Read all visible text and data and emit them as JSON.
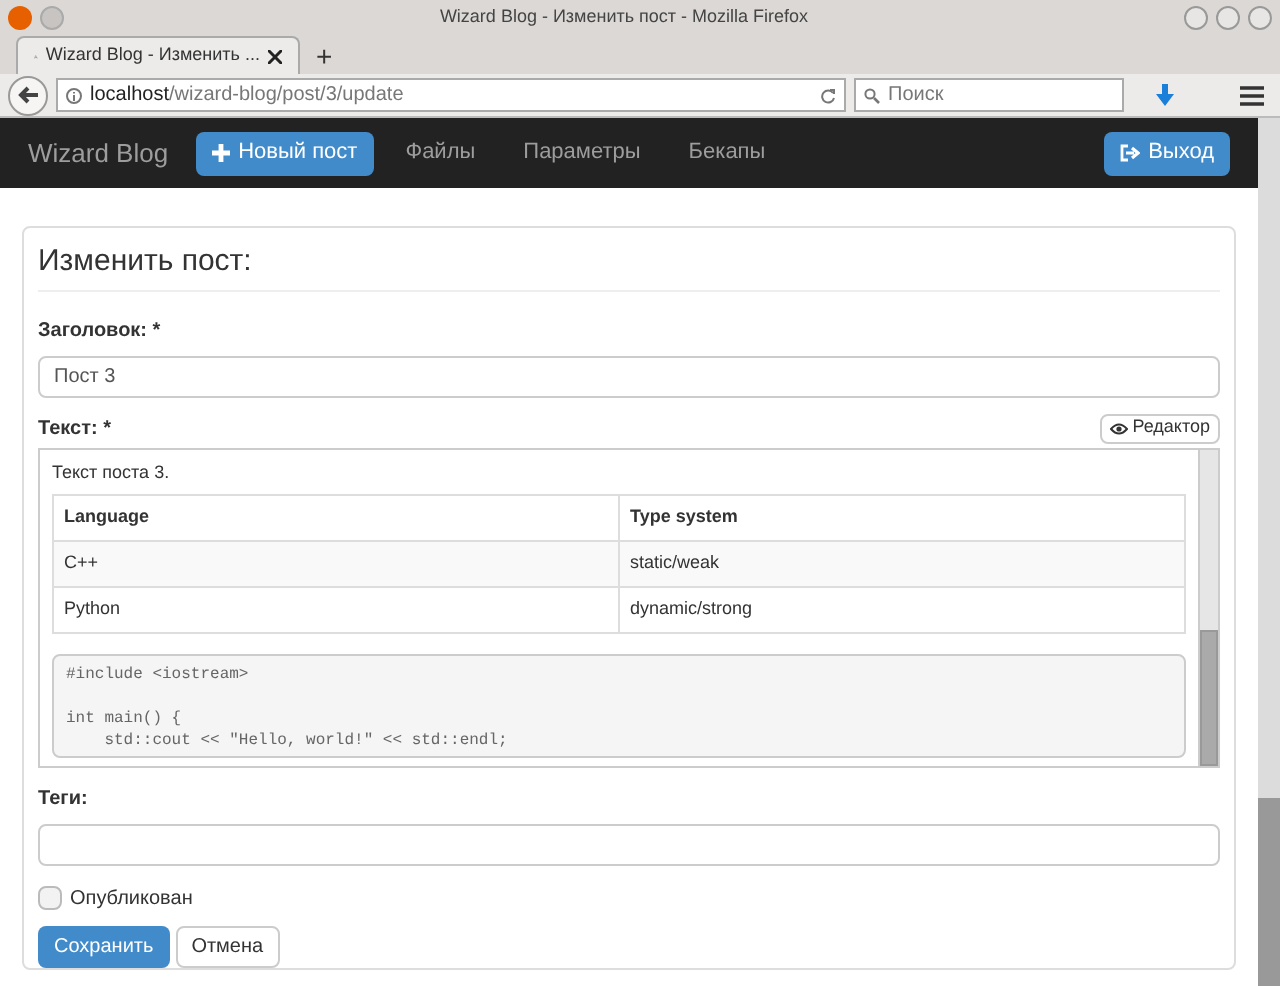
{
  "window": {
    "title": "Wizard Blog - Изменить пост - Mozilla Firefox"
  },
  "tab": {
    "title": "Wizard Blog - Изменить ...",
    "new_tab": "+"
  },
  "address": {
    "host": "localhost",
    "path": "/wizard-blog/post/3/update"
  },
  "search": {
    "placeholder": "Поиск"
  },
  "navbar": {
    "brand": "Wizard Blog",
    "new_post": "Новый пост",
    "links": [
      {
        "label": "Файлы"
      },
      {
        "label": "Параметры"
      },
      {
        "label": "Бекапы"
      }
    ],
    "logout": "Выход"
  },
  "form": {
    "heading": "Изменить пост:",
    "title_label": "Заголовок: *",
    "title_value": "Пост 3",
    "text_label": "Текст: *",
    "editor_button": "Редактор",
    "content": {
      "paragraph": "Текст поста 3.",
      "columns": [
        "Language",
        "Type system"
      ],
      "rows": [
        [
          "C++",
          "static/weak"
        ],
        [
          "Python",
          "dynamic/strong"
        ]
      ],
      "code": "#include <iostream>\n\nint main() {\n    std::cout << \"Hello, world!\" << std::endl;"
    },
    "tags_label": "Теги:",
    "published": {
      "label": "Опубликован",
      "checked": false
    },
    "save": "Сохранить",
    "cancel": "Отмена"
  }
}
